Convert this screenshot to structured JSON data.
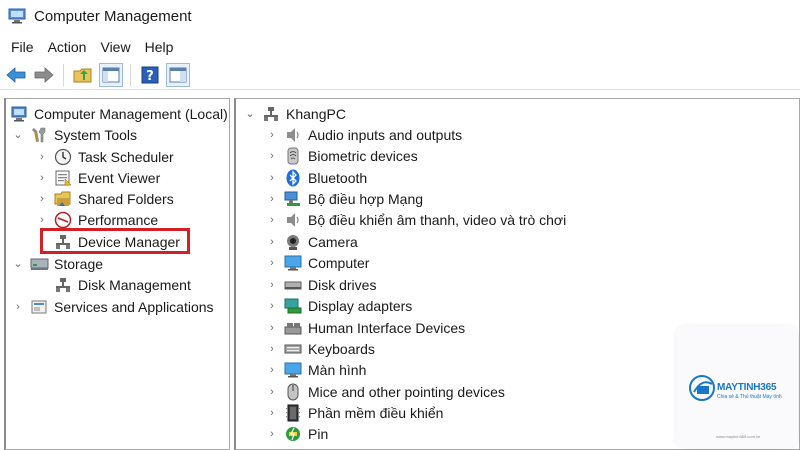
{
  "window": {
    "title": "Computer Management"
  },
  "menu": [
    "File",
    "Action",
    "View",
    "Help"
  ],
  "left_tree": [
    {
      "label": "Computer Management (Local)",
      "icon": "computer-management-icon",
      "chevron": ""
    },
    {
      "label": "System Tools",
      "icon": "system-tools-icon",
      "chevron": "expanded"
    },
    {
      "label": "Task Scheduler",
      "icon": "task-scheduler-icon",
      "chevron": "collapsed"
    },
    {
      "label": "Event Viewer",
      "icon": "event-viewer-icon",
      "chevron": "collapsed"
    },
    {
      "label": "Shared Folders",
      "icon": "shared-folders-icon",
      "chevron": "collapsed"
    },
    {
      "label": "Performance",
      "icon": "performance-icon",
      "chevron": "collapsed"
    },
    {
      "label": "Device Manager",
      "icon": "device-manager-icon",
      "chevron": ""
    },
    {
      "label": "Storage",
      "icon": "storage-icon",
      "chevron": "expanded"
    },
    {
      "label": "Disk Management",
      "icon": "disk-management-icon",
      "chevron": ""
    },
    {
      "label": "Services and Applications",
      "icon": "services-icon",
      "chevron": "collapsed"
    }
  ],
  "right_tree": {
    "root": "KhangPC",
    "items": [
      "Audio inputs and outputs",
      "Biometric devices",
      "Bluetooth",
      "Bộ điều hợp Mạng",
      "Bộ điều khiển âm thanh, video và trò chơi",
      "Camera",
      "Computer",
      "Disk drives",
      "Display adapters",
      "Human Interface Devices",
      "Keyboards",
      "Màn hình",
      "Mice and other pointing devices",
      "Phần mềm điều khiển",
      "Pin"
    ]
  },
  "watermark": {
    "brand": "MAYTINH365",
    "tagline": "Chia sẻ & Thủ thuật Máy tính",
    "url": "www.maytinh365.com.vn"
  },
  "colors": {
    "highlight": "#d31f26",
    "accent": "#1877c9"
  }
}
